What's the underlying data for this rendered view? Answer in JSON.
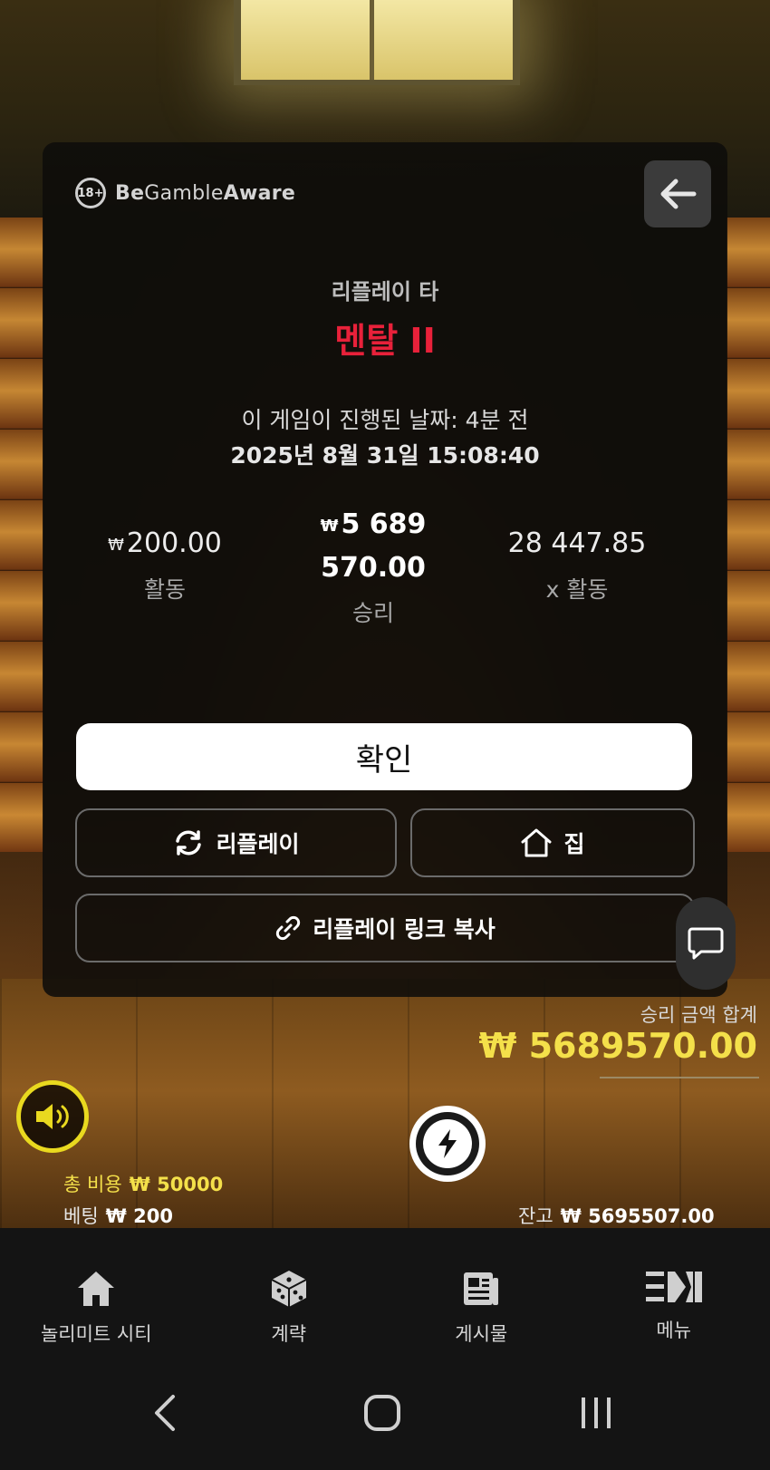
{
  "header": {
    "aware_brand_plain_1": "Be",
    "aware_brand_plain_2": "Gamble",
    "aware_brand_plain_3": "Aware",
    "age_badge": "18+"
  },
  "replay": {
    "title": "리플레이 타",
    "game_name": "멘탈 II",
    "played_ago": "이 게임이 진행된 날짜: 4분 전",
    "played_date": "2025년 8월 31일 15:08:40"
  },
  "stats": {
    "currency_symbol": "₩",
    "bet_value": "200.00",
    "bet_label": "활동",
    "win_value_line1": "5 689",
    "win_value_line2": "570.00",
    "win_label": "승리",
    "multiplier_value": "28 447.85",
    "multiplier_label": "x 활동"
  },
  "buttons": {
    "confirm": "확인",
    "replay": "리플레이",
    "home": "집",
    "copy_link": "리플레이 링크 복사"
  },
  "hud": {
    "total_win_label": "승리 금액 합계",
    "total_win_value": "₩ 5689570.00",
    "total_cost_label": "총 비용",
    "total_cost_value": "₩ 50000",
    "bet_label": "베팅",
    "bet_value": "₩ 200",
    "balance_label": "잔고",
    "balance_value": "₩ 5695507.00",
    "accent_yellow": "#f4e04a"
  },
  "bottom_nav": {
    "items": [
      {
        "label": "놀리미트 시티",
        "icon": "home-icon"
      },
      {
        "label": "계략",
        "icon": "dice-icon"
      },
      {
        "label": "게시물",
        "icon": "newspaper-icon"
      },
      {
        "label": "메뉴",
        "icon": "menu-icon"
      }
    ]
  },
  "colors": {
    "game_name": "#e8213a",
    "modal_bg": "#0e0c0a",
    "confirm_bg": "#ffffff"
  }
}
